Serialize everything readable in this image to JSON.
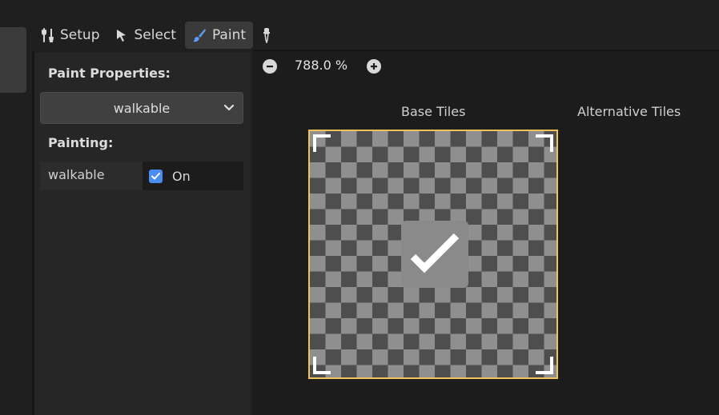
{
  "toolbar": {
    "setup_label": "Setup",
    "select_label": "Select",
    "paint_label": "Paint",
    "active_tab": "Paint"
  },
  "panel": {
    "paint_properties_title": "Paint Properties:",
    "property_dropdown_value": "walkable",
    "painting_title": "Painting:",
    "painting_property_label": "walkable",
    "painting_checkbox_checked": true,
    "painting_value_label": "On"
  },
  "view": {
    "zoom_level": "788.0 %",
    "base_tiles_label": "Base Tiles",
    "alternative_tiles_label": "Alternative Tiles"
  },
  "colors": {
    "accent_blue": "#4a8cf0",
    "selection_yellow": "#f2c35a"
  },
  "icons": [
    "wrench-icon",
    "cursor-arrow-icon",
    "brush-icon",
    "eyedropper-icon",
    "zoom-out-icon",
    "zoom-in-icon",
    "chevron-down-icon",
    "checkmark-icon"
  ]
}
